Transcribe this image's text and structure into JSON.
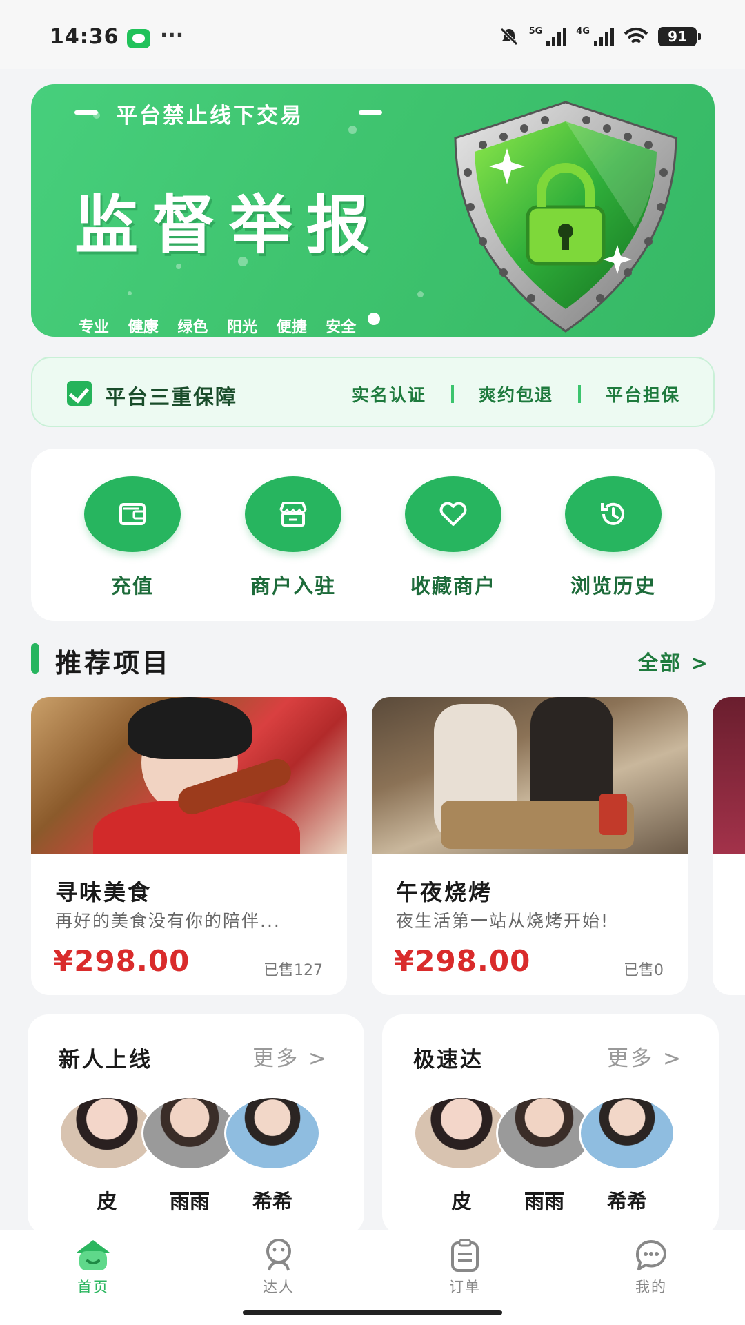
{
  "status_bar": {
    "time": "14:36",
    "more": "···",
    "net1": "5G",
    "net2": "4G",
    "battery": "91"
  },
  "banner": {
    "top_text": "平台禁止线下交易",
    "title": "监督举报",
    "subtitle": "专业 健康 绿色 阳光 便捷 安全"
  },
  "guarantee": {
    "title": "平台三重保障",
    "items": [
      "实名认证",
      "爽约包退",
      "平台担保"
    ]
  },
  "actions": [
    {
      "label": "充值",
      "icon": "wallet-icon"
    },
    {
      "label": "商户入驻",
      "icon": "store-icon"
    },
    {
      "label": "收藏商户",
      "icon": "heart-icon"
    },
    {
      "label": "浏览历史",
      "icon": "history-icon"
    }
  ],
  "section": {
    "title": "推荐项目",
    "all_label": "全部 >"
  },
  "products": [
    {
      "name": "寻味美食",
      "desc": "再好的美食没有你的陪伴...",
      "price": "¥298.00",
      "sold": "已售127"
    },
    {
      "name": "午夜烧烤",
      "desc": "夜生活第一站从烧烤开始!",
      "price": "¥298.00",
      "sold": "已售0"
    }
  ],
  "mini_cards": [
    {
      "title": "新人上线",
      "more": "更多 >",
      "names": [
        "皮",
        "雨雨",
        "希希"
      ]
    },
    {
      "title": "极速达",
      "more": "更多 >",
      "names": [
        "皮",
        "雨雨",
        "希希"
      ]
    }
  ],
  "tabs": [
    {
      "label": "首页",
      "icon": "home-icon",
      "active": true
    },
    {
      "label": "达人",
      "icon": "talent-icon",
      "active": false
    },
    {
      "label": "订单",
      "icon": "order-icon",
      "active": false
    },
    {
      "label": "我的",
      "icon": "profile-icon",
      "active": false
    }
  ],
  "colors": {
    "brand_green": "#27b55f",
    "price_red": "#d92b2b"
  }
}
